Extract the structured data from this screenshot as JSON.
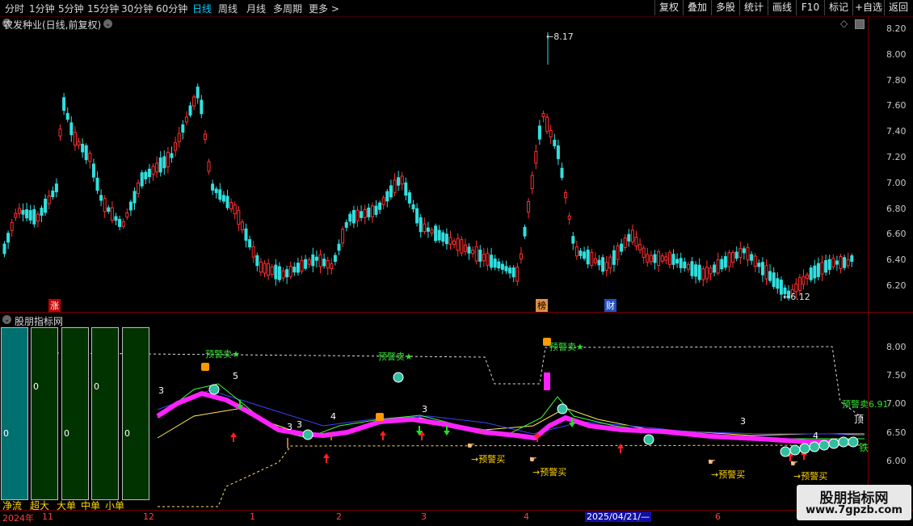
{
  "toolbar": {
    "timeframes": [
      "分时",
      "1分钟",
      "5分钟",
      "15分钟",
      "30分钟",
      "60分钟",
      "日线",
      "周线",
      "月线",
      "多周期",
      "更多 >"
    ],
    "active_timeframe": "日线",
    "buttons": [
      "复权",
      "叠加",
      "多股",
      "统计",
      "画线",
      "F10",
      "标记",
      "+自选",
      "返回"
    ]
  },
  "main_chart": {
    "title": "农发种业(日线,前复权)",
    "price_axis": [
      "8.20",
      "8.00",
      "7.80",
      "7.60",
      "7.40",
      "7.20",
      "7.00",
      "6.80",
      "6.60",
      "6.40",
      "6.20"
    ],
    "high_label": "8.17",
    "low_label": "6.12",
    "markers": [
      "涨",
      "榜",
      "财"
    ]
  },
  "indicator_chart": {
    "title": "股朋指标网",
    "axis": [
      "8.00",
      "7.50",
      "7.00",
      "6.50",
      "6.00"
    ],
    "warn_sell_label": "预警卖",
    "warn_buy_label": "→预警买",
    "value_label": "预警卖6.91",
    "right_tags": [
      "顶",
      "铁"
    ],
    "numbers": [
      "3",
      "5",
      "3",
      "3",
      "4",
      "3",
      "3",
      "4"
    ]
  },
  "volume_legend": {
    "labels": [
      "净流",
      "超大",
      "大单",
      "中单",
      "小单"
    ],
    "values": [
      "0",
      "0",
      "0",
      "0",
      "0"
    ]
  },
  "dates": [
    "2024年",
    "11",
    "12",
    "1",
    "2",
    "3",
    "4",
    "2025/04/21/—",
    "6"
  ],
  "watermark": {
    "title": "股朋指标网",
    "url": "www.7gpzb.com"
  },
  "colors": {
    "up": "#ff3030",
    "down": "#30e0e0",
    "magenta": "#ff22ff",
    "warn_sell": "#30e030",
    "warn_buy": "#ffd200"
  }
}
